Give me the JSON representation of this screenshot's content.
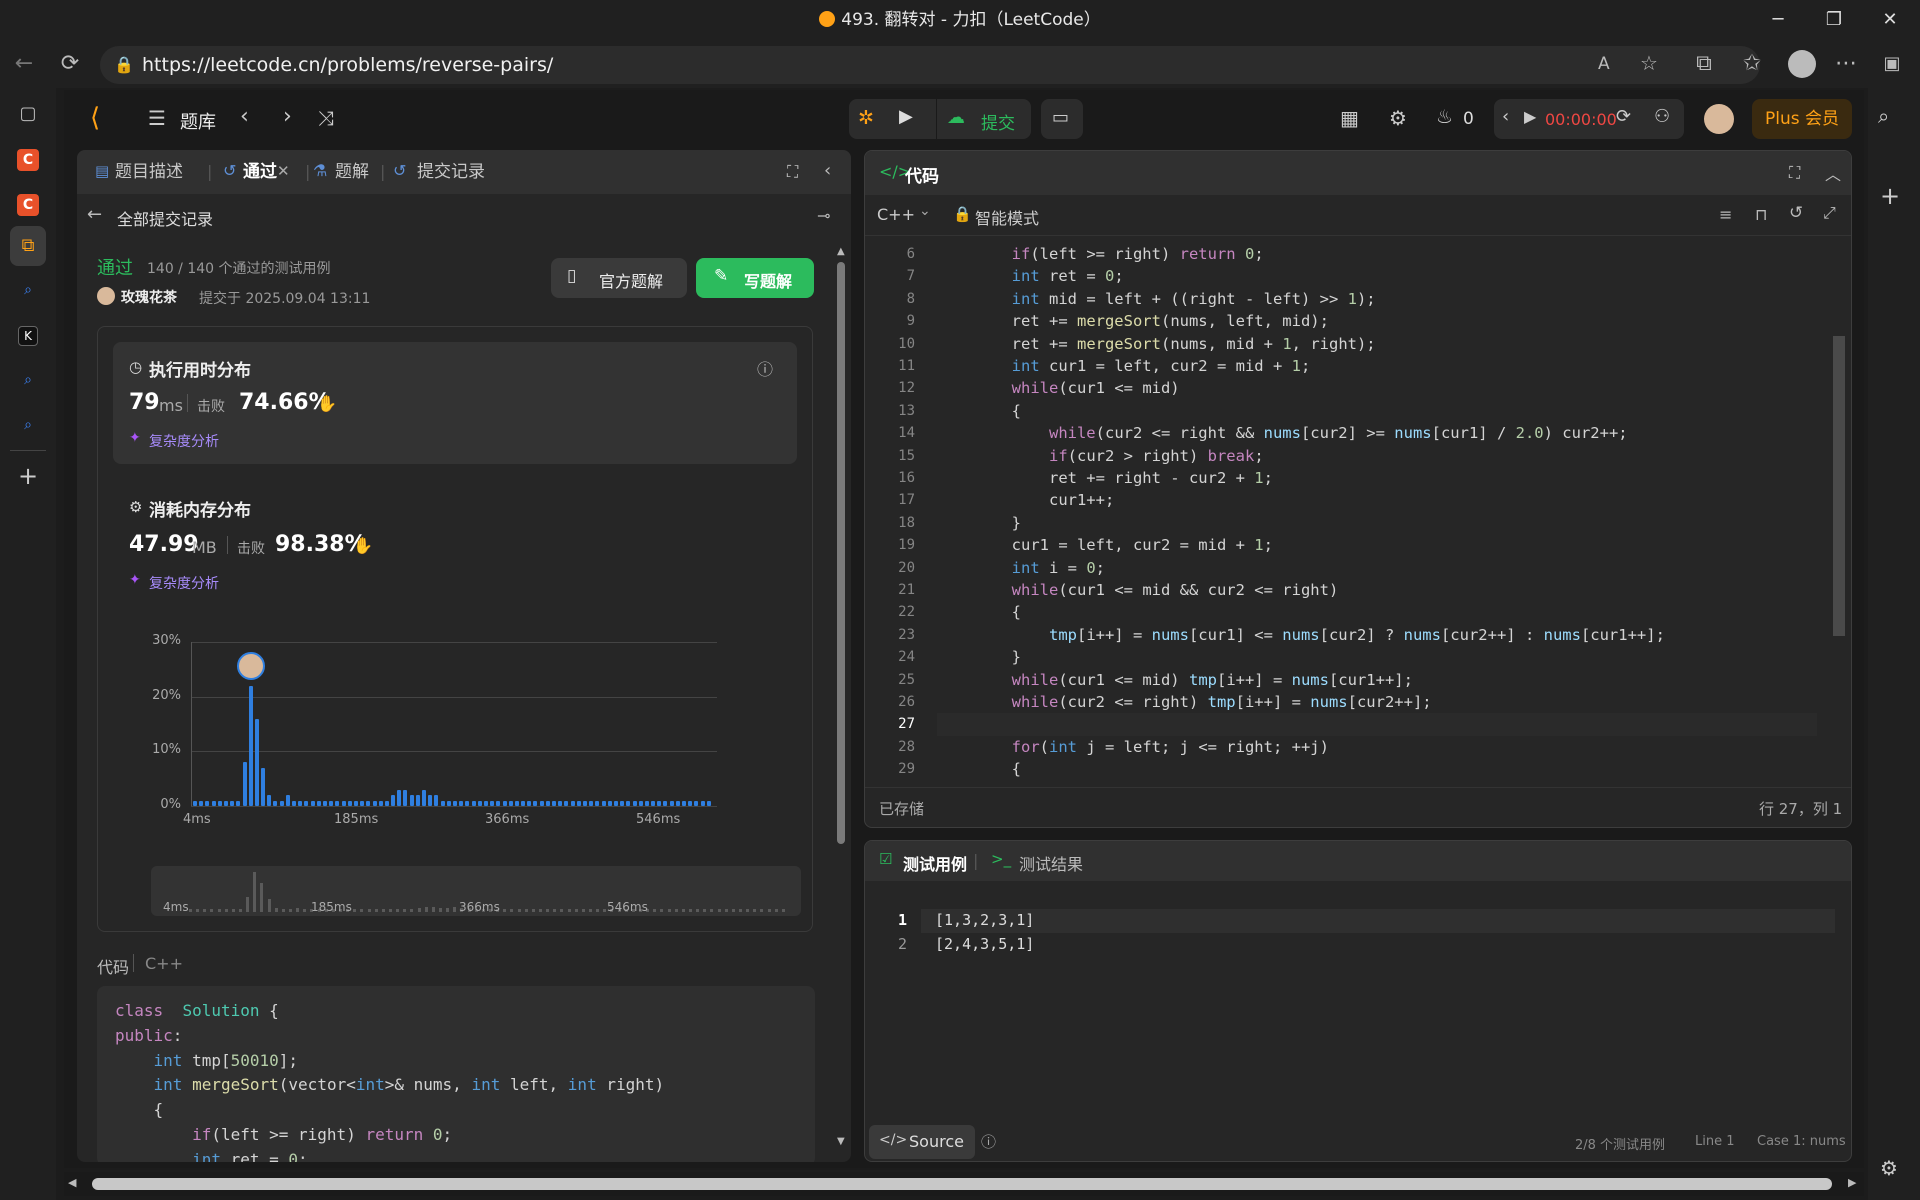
{
  "window": {
    "title": "493. 翻转对 - 力扣（LeetCode）",
    "controls": [
      "─",
      "❐",
      "✕"
    ]
  },
  "browser": {
    "url": "https://leetcode.cn/problems/reverse-pairs/"
  },
  "header": {
    "problem_list": "题库",
    "submit": "提交",
    "streak": "0",
    "timer": "00:00:00",
    "plus": "Plus 会员"
  },
  "left_panel": {
    "tabs": [
      "题目描述",
      "通过",
      "题解",
      "提交记录"
    ],
    "back": "全部提交记录",
    "status": "通过",
    "cases": "140 / 140 个通过的测试用例",
    "user": "玫瑰花茶",
    "submitted": "提交于 2025.09.04 13:11",
    "official_btn": "官方题解",
    "write_btn": "写题解",
    "runtime": {
      "title": "执行用时分布",
      "value": "79",
      "unit": "ms",
      "beat_label": "击败",
      "beat": "74.66%",
      "analysis": "复杂度分析"
    },
    "memory": {
      "title": "消耗内存分布",
      "value": "47.99",
      "unit": "MB",
      "beat_label": "击败",
      "beat": "98.38%",
      "analysis": "复杂度分析"
    },
    "code_label": "代码",
    "code_lang": "C++"
  },
  "chart_data": {
    "type": "bar",
    "y_ticks": [
      "30%",
      "20%",
      "10%",
      "0%"
    ],
    "ylim": [
      0,
      30
    ],
    "x_ticks": [
      "4ms",
      "185ms",
      "366ms",
      "546ms"
    ],
    "values": [
      1,
      1,
      1,
      1,
      1,
      1,
      1,
      1,
      8,
      22,
      16,
      7,
      2,
      1,
      1,
      2,
      1,
      1,
      1,
      1,
      1,
      1,
      1,
      1,
      1,
      1,
      1,
      1,
      1,
      1,
      1,
      1,
      2,
      3,
      3,
      2,
      2,
      3,
      2,
      2,
      1,
      1,
      1,
      1,
      1,
      1,
      1,
      1,
      1,
      1,
      1,
      1,
      1,
      1,
      1,
      1,
      1,
      1,
      1,
      1,
      1,
      1,
      1,
      1,
      1,
      1,
      1,
      1,
      1,
      1,
      1,
      1,
      1,
      1,
      1,
      1,
      1,
      1,
      1,
      1,
      1,
      1,
      1,
      1
    ],
    "highlight_index": 9,
    "minimap_x_ticks": [
      "4ms",
      "185ms",
      "366ms",
      "546ms"
    ]
  },
  "left_code": [
    [
      [
        "kw",
        "class"
      ],
      [
        "",
        "  "
      ],
      [
        "cl",
        "Solution"
      ],
      [
        "",
        " {"
      ]
    ],
    [
      [
        "kw",
        "public"
      ],
      [
        "",
        ":"
      ]
    ],
    [
      [
        "",
        "    "
      ],
      [
        "ty",
        "int"
      ],
      [
        "",
        " tmp["
      ],
      [
        "nm",
        "50010"
      ],
      [
        "",
        "];"
      ]
    ],
    [
      [
        "",
        "    "
      ],
      [
        "ty",
        "int"
      ],
      [
        "",
        " "
      ],
      [
        "fn",
        "mergeSort"
      ],
      [
        "",
        "(vector<"
      ],
      [
        "ty",
        "int"
      ],
      [
        "",
        ">& nums, "
      ],
      [
        "ty",
        "int"
      ],
      [
        "",
        " left, "
      ],
      [
        "ty",
        "int"
      ],
      [
        "",
        " right)"
      ]
    ],
    [
      [
        "",
        "    {"
      ]
    ],
    [
      [
        "",
        "        "
      ],
      [
        "kw",
        "if"
      ],
      [
        "",
        "(left >= right) "
      ],
      [
        "kw",
        "return"
      ],
      [
        "",
        " "
      ],
      [
        "nm",
        "0"
      ],
      [
        "",
        ";"
      ]
    ],
    [
      [
        "",
        "        "
      ],
      [
        "ty",
        "int"
      ],
      [
        "",
        " ret = "
      ],
      [
        "nm",
        "0"
      ],
      [
        "",
        ";"
      ]
    ]
  ],
  "right_panel": {
    "title": "代码",
    "lang": "C++",
    "mode": "智能模式",
    "saved": "已存储",
    "cursor": "行 27，列 1",
    "start_line": 6,
    "code": [
      [
        [
          "",
          "        "
        ],
        [
          "kw",
          "if"
        ],
        [
          "",
          "(left >= right) "
        ],
        [
          "kw",
          "return"
        ],
        [
          "",
          " "
        ],
        [
          "nm",
          "0"
        ],
        [
          "",
          ";"
        ]
      ],
      [
        [
          "",
          "        "
        ],
        [
          "ty",
          "int"
        ],
        [
          "",
          " ret = "
        ],
        [
          "nm",
          "0"
        ],
        [
          "",
          ";"
        ]
      ],
      [
        [
          "",
          "        "
        ],
        [
          "ty",
          "int"
        ],
        [
          "",
          " mid = left + ((right - left) >> "
        ],
        [
          "nm",
          "1"
        ],
        [
          "",
          "); "
        ]
      ],
      [
        [
          "",
          "        ret += "
        ],
        [
          "fn",
          "mergeSort"
        ],
        [
          "",
          "(nums, left, mid);"
        ]
      ],
      [
        [
          "",
          "        ret += "
        ],
        [
          "fn",
          "mergeSort"
        ],
        [
          "",
          "(nums, mid + "
        ],
        [
          "nm",
          "1"
        ],
        [
          "",
          ", right);"
        ]
      ],
      [
        [
          "",
          "        "
        ],
        [
          "ty",
          "int"
        ],
        [
          "",
          " cur1 = left, cur2 = mid + "
        ],
        [
          "nm",
          "1"
        ],
        [
          "",
          ";"
        ]
      ],
      [
        [
          "",
          "        "
        ],
        [
          "kw",
          "while"
        ],
        [
          "",
          "(cur1 <= mid)"
        ]
      ],
      [
        [
          "",
          "        {"
        ]
      ],
      [
        [
          "",
          "            "
        ],
        [
          "kw",
          "while"
        ],
        [
          "",
          "(cur2 <= right && "
        ],
        [
          "vr",
          "nums"
        ],
        [
          "",
          "[cur2] >= "
        ],
        [
          "vr",
          "nums"
        ],
        [
          "",
          "[cur1] / "
        ],
        [
          "nm",
          "2.0"
        ],
        [
          "",
          ") cur2++;"
        ]
      ],
      [
        [
          "",
          "            "
        ],
        [
          "kw",
          "if"
        ],
        [
          "",
          "(cur2 > right) "
        ],
        [
          "kw",
          "break"
        ],
        [
          "",
          ";"
        ]
      ],
      [
        [
          "",
          "            ret += right - cur2 + "
        ],
        [
          "nm",
          "1"
        ],
        [
          "",
          ";"
        ]
      ],
      [
        [
          "",
          "            cur1++;"
        ]
      ],
      [
        [
          "",
          "        }"
        ]
      ],
      [
        [
          "",
          "        cur1 = left, cur2 = mid + "
        ],
        [
          "nm",
          "1"
        ],
        [
          "",
          ";"
        ]
      ],
      [
        [
          "",
          "        "
        ],
        [
          "ty",
          "int"
        ],
        [
          "",
          " i = "
        ],
        [
          "nm",
          "0"
        ],
        [
          "",
          ";"
        ]
      ],
      [
        [
          "",
          "        "
        ],
        [
          "kw",
          "while"
        ],
        [
          "",
          "(cur1 <= mid && cur2 <= right)"
        ]
      ],
      [
        [
          "",
          "        {"
        ]
      ],
      [
        [
          "",
          "            "
        ],
        [
          "vr",
          "tmp"
        ],
        [
          "",
          "[i++] = "
        ],
        [
          "vr",
          "nums"
        ],
        [
          "",
          "[cur1] <= "
        ],
        [
          "vr",
          "nums"
        ],
        [
          "",
          "[cur2] ? "
        ],
        [
          "vr",
          "nums"
        ],
        [
          "",
          "[cur2++] : "
        ],
        [
          "vr",
          "nums"
        ],
        [
          "",
          "[cur1++];"
        ]
      ],
      [
        [
          "",
          "        }"
        ]
      ],
      [
        [
          "",
          "        "
        ],
        [
          "kw",
          "while"
        ],
        [
          "",
          "(cur1 <= mid) "
        ],
        [
          "vr",
          "tmp"
        ],
        [
          "",
          "[i++] = "
        ],
        [
          "vr",
          "nums"
        ],
        [
          "",
          "[cur1++];"
        ]
      ],
      [
        [
          "",
          "        "
        ],
        [
          "kw",
          "while"
        ],
        [
          "",
          "(cur2 <= right) "
        ],
        [
          "vr",
          "tmp"
        ],
        [
          "",
          "[i++] = "
        ],
        [
          "vr",
          "nums"
        ],
        [
          "",
          "[cur2++];"
        ]
      ],
      [
        [
          "",
          " "
        ]
      ],
      [
        [
          "",
          "        "
        ],
        [
          "kw",
          "for"
        ],
        [
          "",
          "("
        ],
        [
          "ty",
          "int"
        ],
        [
          "",
          " j = left; j <= right; ++j)"
        ]
      ],
      [
        [
          "",
          "        {"
        ]
      ]
    ]
  },
  "test_panel": {
    "tab_cases": "测试用例",
    "tab_results": "测试结果",
    "lines": [
      {
        "n": "1",
        "t": "[1,3,2,3,1]"
      },
      {
        "n": "2",
        "t": "[2,4,3,5,1]"
      }
    ],
    "source_btn": "Source",
    "footer": [
      "2/8 个测试用例",
      "Line 1",
      "Case 1: nums"
    ]
  },
  "colors": {
    "accent_green": "#2cbb5d",
    "accent_orange": "#ffa116",
    "bar_blue": "#2f7fe0"
  }
}
